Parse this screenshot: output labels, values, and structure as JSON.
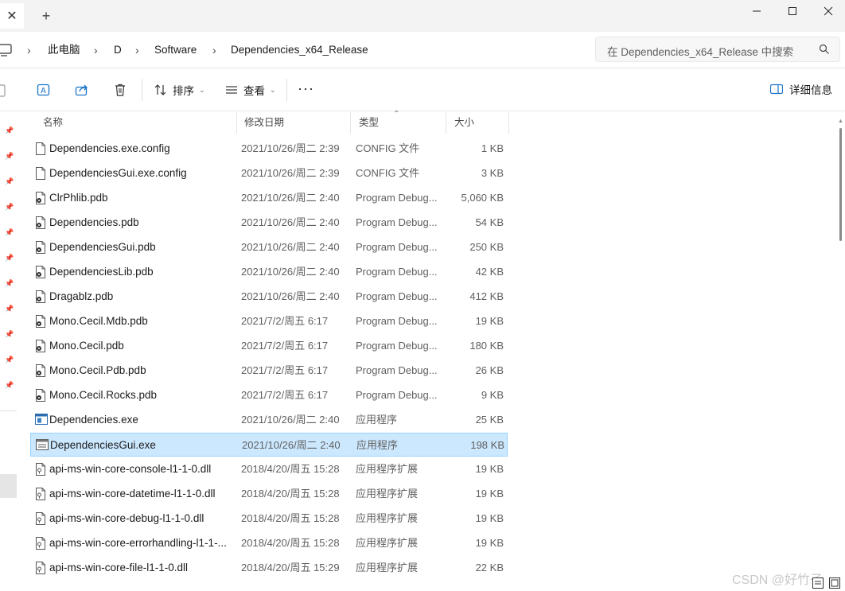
{
  "titlebar": {
    "close_tab_glyph": "✕",
    "new_tab_glyph": "+"
  },
  "breadcrumb": {
    "items": [
      "此电脑",
      "D",
      "Software",
      "Dependencies_x64_Release"
    ]
  },
  "search": {
    "placeholder": "在 Dependencies_x64_Release 中搜索"
  },
  "toolbar": {
    "sort_label": "排序",
    "view_label": "查看",
    "more_label": "···",
    "details_label": "详细信息"
  },
  "columns": {
    "name": "名称",
    "date": "修改日期",
    "type": "类型",
    "size": "大小"
  },
  "files": [
    {
      "name": "Dependencies.exe.config",
      "date": "2021/10/26/周二 2:39",
      "type": "CONFIG 文件",
      "size": "1 KB",
      "icon": "file-icon"
    },
    {
      "name": "DependenciesGui.exe.config",
      "date": "2021/10/26/周二 2:39",
      "type": "CONFIG 文件",
      "size": "3 KB",
      "icon": "file-icon"
    },
    {
      "name": "ClrPhlib.pdb",
      "date": "2021/10/26/周二 2:40",
      "type": "Program Debug...",
      "size": "5,060 KB",
      "icon": "pdb-icon"
    },
    {
      "name": "Dependencies.pdb",
      "date": "2021/10/26/周二 2:40",
      "type": "Program Debug...",
      "size": "54 KB",
      "icon": "pdb-icon"
    },
    {
      "name": "DependenciesGui.pdb",
      "date": "2021/10/26/周二 2:40",
      "type": "Program Debug...",
      "size": "250 KB",
      "icon": "pdb-icon"
    },
    {
      "name": "DependenciesLib.pdb",
      "date": "2021/10/26/周二 2:40",
      "type": "Program Debug...",
      "size": "42 KB",
      "icon": "pdb-icon"
    },
    {
      "name": "Dragablz.pdb",
      "date": "2021/10/26/周二 2:40",
      "type": "Program Debug...",
      "size": "412 KB",
      "icon": "pdb-icon"
    },
    {
      "name": "Mono.Cecil.Mdb.pdb",
      "date": "2021/7/2/周五 6:17",
      "type": "Program Debug...",
      "size": "19 KB",
      "icon": "pdb-icon"
    },
    {
      "name": "Mono.Cecil.pdb",
      "date": "2021/7/2/周五 6:17",
      "type": "Program Debug...",
      "size": "180 KB",
      "icon": "pdb-icon"
    },
    {
      "name": "Mono.Cecil.Pdb.pdb",
      "date": "2021/7/2/周五 6:17",
      "type": "Program Debug...",
      "size": "26 KB",
      "icon": "pdb-icon"
    },
    {
      "name": "Mono.Cecil.Rocks.pdb",
      "date": "2021/7/2/周五 6:17",
      "type": "Program Debug...",
      "size": "9 KB",
      "icon": "pdb-icon"
    },
    {
      "name": "Dependencies.exe",
      "date": "2021/10/26/周二 2:40",
      "type": "应用程序",
      "size": "25 KB",
      "icon": "exe-icon"
    },
    {
      "name": "DependenciesGui.exe",
      "date": "2021/10/26/周二 2:40",
      "type": "应用程序",
      "size": "198 KB",
      "icon": "exe-gui-icon",
      "selected": true
    },
    {
      "name": "api-ms-win-core-console-l1-1-0.dll",
      "date": "2018/4/20/周五 15:28",
      "type": "应用程序扩展",
      "size": "19 KB",
      "icon": "dll-icon"
    },
    {
      "name": "api-ms-win-core-datetime-l1-1-0.dll",
      "date": "2018/4/20/周五 15:28",
      "type": "应用程序扩展",
      "size": "19 KB",
      "icon": "dll-icon"
    },
    {
      "name": "api-ms-win-core-debug-l1-1-0.dll",
      "date": "2018/4/20/周五 15:28",
      "type": "应用程序扩展",
      "size": "19 KB",
      "icon": "dll-icon"
    },
    {
      "name": "api-ms-win-core-errorhandling-l1-1-...",
      "date": "2018/4/20/周五 15:28",
      "type": "应用程序扩展",
      "size": "19 KB",
      "icon": "dll-icon"
    },
    {
      "name": "api-ms-win-core-file-l1-1-0.dll",
      "date": "2018/4/20/周五 15:29",
      "type": "应用程序扩展",
      "size": "22 KB",
      "icon": "dll-icon"
    }
  ],
  "watermark": "CSDN @好竹子",
  "colors": {
    "selection_bg": "#cce8ff",
    "selection_border": "#99d1ff",
    "accent": "#0067c0"
  }
}
